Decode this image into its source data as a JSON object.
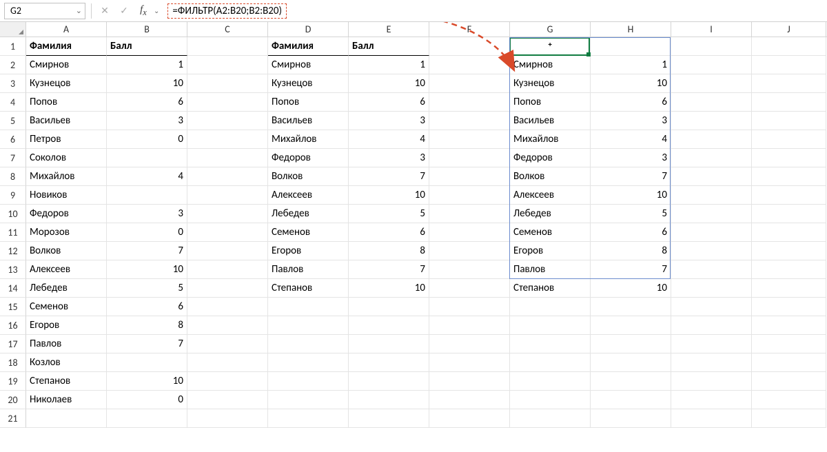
{
  "formula_bar": {
    "cell_ref": "G2",
    "formula": "=ФИЛЬТР(A2:B20;B2:B20)"
  },
  "columns": [
    "A",
    "B",
    "C",
    "D",
    "E",
    "F",
    "G",
    "H",
    "I",
    "J"
  ],
  "row_numbers": [
    1,
    2,
    3,
    4,
    5,
    6,
    7,
    8,
    9,
    10,
    11,
    12,
    13,
    14,
    15,
    16,
    17,
    18,
    19,
    20,
    21
  ],
  "headers": {
    "fam": "Фамилия",
    "score": "Балл"
  },
  "table_ab": [
    {
      "name": "Смирнов",
      "score": 1
    },
    {
      "name": "Кузнецов",
      "score": 10
    },
    {
      "name": "Попов",
      "score": 6
    },
    {
      "name": "Васильев",
      "score": 3
    },
    {
      "name": "Петров",
      "score": 0
    },
    {
      "name": "Соколов",
      "score": ""
    },
    {
      "name": "Михайлов",
      "score": 4
    },
    {
      "name": "Новиков",
      "score": ""
    },
    {
      "name": "Федоров",
      "score": 3
    },
    {
      "name": "Морозов",
      "score": 0
    },
    {
      "name": "Волков",
      "score": 7
    },
    {
      "name": "Алексеев",
      "score": 10
    },
    {
      "name": "Лебедев",
      "score": 5
    },
    {
      "name": "Семенов",
      "score": 6
    },
    {
      "name": "Егоров",
      "score": 8
    },
    {
      "name": "Павлов",
      "score": 7
    },
    {
      "name": "Козлов",
      "score": ""
    },
    {
      "name": "Степанов",
      "score": 10
    },
    {
      "name": "Николаев",
      "score": 0
    }
  ],
  "table_de": [
    {
      "name": "Смирнов",
      "score": 1
    },
    {
      "name": "Кузнецов",
      "score": 10
    },
    {
      "name": "Попов",
      "score": 6
    },
    {
      "name": "Васильев",
      "score": 3
    },
    {
      "name": "Михайлов",
      "score": 4
    },
    {
      "name": "Федоров",
      "score": 3
    },
    {
      "name": "Волков",
      "score": 7
    },
    {
      "name": "Алексеев",
      "score": 10
    },
    {
      "name": "Лебедев",
      "score": 5
    },
    {
      "name": "Семенов",
      "score": 6
    },
    {
      "name": "Егоров",
      "score": 8
    },
    {
      "name": "Павлов",
      "score": 7
    },
    {
      "name": "Степанов",
      "score": 10
    }
  ],
  "table_gh": [
    {
      "name": "Смирнов",
      "score": 1
    },
    {
      "name": "Кузнецов",
      "score": 10
    },
    {
      "name": "Попов",
      "score": 6
    },
    {
      "name": "Васильев",
      "score": 3
    },
    {
      "name": "Михайлов",
      "score": 4
    },
    {
      "name": "Федоров",
      "score": 3
    },
    {
      "name": "Волков",
      "score": 7
    },
    {
      "name": "Алексеев",
      "score": 10
    },
    {
      "name": "Лебедев",
      "score": 5
    },
    {
      "name": "Семенов",
      "score": 6
    },
    {
      "name": "Егоров",
      "score": 8
    },
    {
      "name": "Павлов",
      "score": 7
    },
    {
      "name": "Степанов",
      "score": 10
    }
  ]
}
